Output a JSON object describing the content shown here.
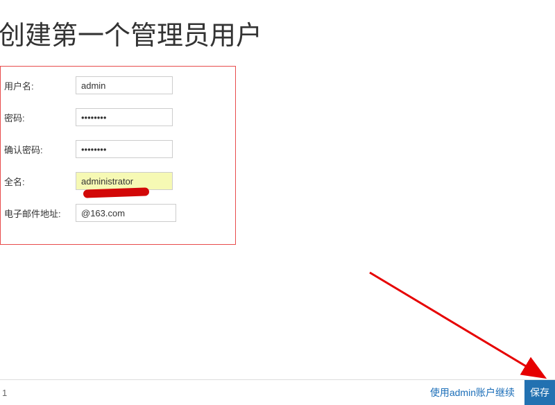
{
  "title": "创建第一个管理员用户",
  "form": {
    "username": {
      "label": "用户名:",
      "value": "admin"
    },
    "password": {
      "label": "密码:",
      "value": "••••••••"
    },
    "confirm_password": {
      "label": "确认密码:",
      "value": "••••••••"
    },
    "fullname": {
      "label": "全名:",
      "value": "administrator"
    },
    "email": {
      "label": "电子邮件地址:",
      "value": "@163.com"
    }
  },
  "footer": {
    "page_number": "1",
    "continue_link": "使用admin账户继续",
    "save_button": "保存"
  }
}
